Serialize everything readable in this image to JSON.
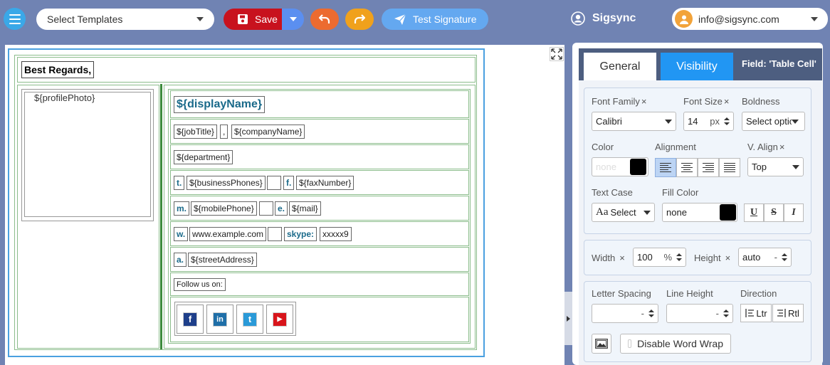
{
  "toolbar": {
    "template_select": "Select Templates",
    "save_label": "Save",
    "test_label": "Test Signature",
    "brand": "Sigsync",
    "user_email": "info@sigsync.com"
  },
  "signature": {
    "greeting": "Best Regards,",
    "profile_photo": "${profilePhoto}",
    "display_name": "${displayName}",
    "job_title": "${jobTitle}",
    "comma": ",",
    "company_name": "${companyName}",
    "department": "${department}",
    "phone_label": "t.",
    "business_phones": "${businessPhones}",
    "fax_label": "f.",
    "fax_number": "${faxNumber}",
    "mobile_label": "m.",
    "mobile_phone": "${mobilePhone}",
    "email_label": "e.",
    "mail": "${mail}",
    "web_label": "w.",
    "website": "www.example.com",
    "skype_label": "skype:",
    "skype": "xxxxx9",
    "address_label": "a.",
    "street_address": "${streetAddress}",
    "follow_text": "Follow us on:",
    "social": [
      {
        "name": "facebook",
        "glyph": "f",
        "color": "#1e3f8a"
      },
      {
        "name": "linkedin",
        "glyph": "in",
        "color": "#1f6fa8"
      },
      {
        "name": "twitter",
        "glyph": "t",
        "color": "#2a9ad8"
      },
      {
        "name": "youtube",
        "glyph": "▶",
        "color": "#d8151b"
      }
    ]
  },
  "panel": {
    "tabs": {
      "general": "General",
      "visibility": "Visibility"
    },
    "field_label": "Field: 'Table Cell'",
    "font_family_label": "Font Family",
    "font_family_value": "Calibri",
    "font_size_label": "Font Size",
    "font_size_value": "14",
    "font_size_unit": "px",
    "boldness_label": "Boldness",
    "boldness_value": "Select option",
    "color_label": "Color",
    "color_placeholder": "none",
    "alignment_label": "Alignment",
    "valign_label": "V. Align",
    "valign_value": "Top",
    "text_case_label": "Text Case",
    "text_case_value": "Select",
    "text_case_prefix": "Aa",
    "fill_color_label": "Fill Color",
    "fill_color_value": "none",
    "underline": "U",
    "strike": "S",
    "italic": "I",
    "width_label": "Width",
    "width_value": "100",
    "width_unit": "%",
    "height_label": "Height",
    "height_value": "auto",
    "height_unit": "-",
    "letter_spacing_label": "Letter Spacing",
    "letter_spacing_unit": "-",
    "line_height_label": "Line Height",
    "line_height_unit": "-",
    "direction_label": "Direction",
    "ltr": "Ltr",
    "rtl": "Rtl",
    "disable_wrap": "Disable Word Wrap",
    "clear": "×"
  },
  "colors": {
    "accent": "#2196f3",
    "save": "#c8121e",
    "undo": "#ec6b30",
    "redo": "#f0a11c",
    "test": "#64a8f0",
    "border_green": "#8cbd8c",
    "label_teal": "#1a6a8a"
  }
}
